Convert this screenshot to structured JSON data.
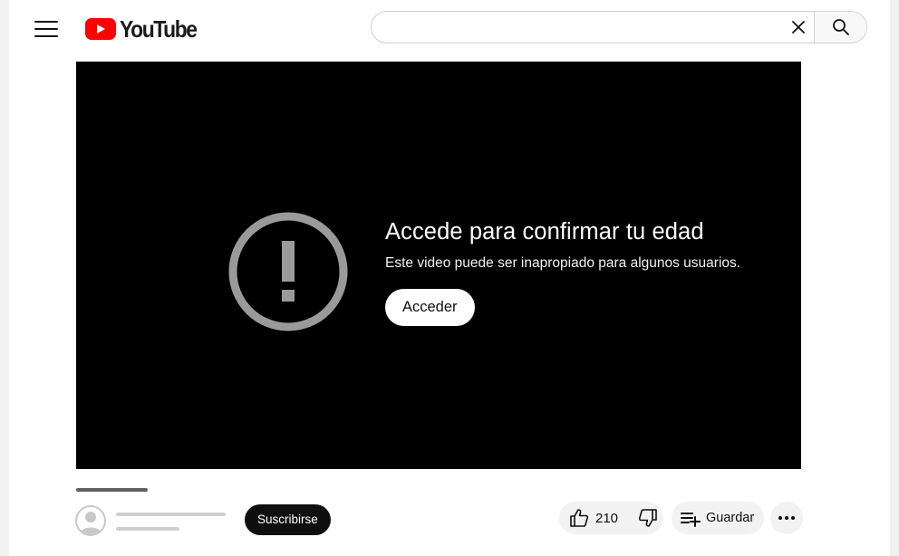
{
  "header": {
    "logo_text": "YouTube",
    "search_value": "",
    "search_placeholder": ""
  },
  "player": {
    "gate_title": "Accede para confirmar tu edad",
    "gate_message": "Este video puede ser inapropiado para algunos usuarios.",
    "gate_button": "Acceder"
  },
  "actions": {
    "subscribe_label": "Suscribirse",
    "like_count": "210",
    "save_label": "Guardar"
  },
  "colors": {
    "brand_red": "#ff0000",
    "player_bg": "#000000",
    "warning_icon": "#9a9a9a",
    "action_chip_bg": "#f2f2f2"
  }
}
